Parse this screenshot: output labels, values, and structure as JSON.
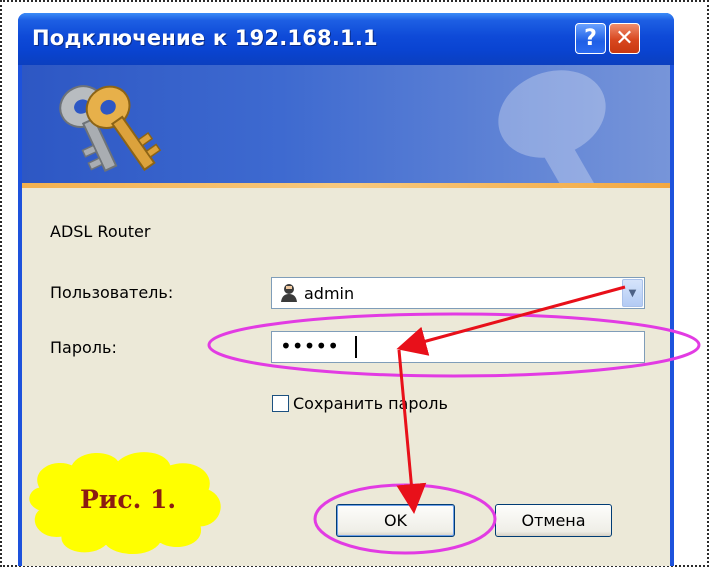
{
  "window": {
    "title": "Подключение к 192.168.1.1",
    "help_icon": "question-mark",
    "close_icon": "x-mark"
  },
  "dialog": {
    "realm": "ADSL Router",
    "username_label": "Пользователь:",
    "username_value": "admin",
    "password_label": "Пароль:",
    "password_value": "•••••",
    "remember_label": "Сохранить пароль",
    "remember_checked": false,
    "ok_label": "OK",
    "cancel_label": "Отмена"
  },
  "annotation": {
    "figure_label": "Рис. 1.",
    "highlight_color": "#e23be3",
    "arrow_color": "#e8101a",
    "cloud_color": "#ffff00"
  },
  "colors": {
    "titlebar": "#0a44d2",
    "dialog_bg": "#ece9d8",
    "banner": "#3e6ad0"
  }
}
